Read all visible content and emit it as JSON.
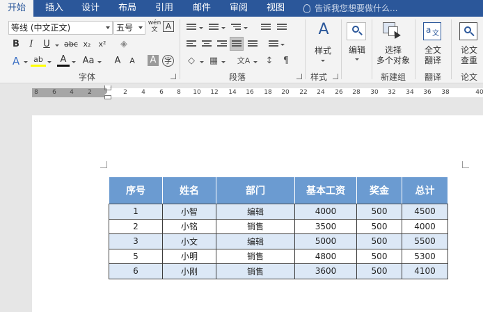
{
  "tabs": [
    {
      "label": "开始",
      "active": true
    },
    {
      "label": "插入"
    },
    {
      "label": "设计"
    },
    {
      "label": "布局"
    },
    {
      "label": "引用"
    },
    {
      "label": "邮件"
    },
    {
      "label": "审阅"
    },
    {
      "label": "视图"
    }
  ],
  "tell_me": "告诉我您想要做什么...",
  "ribbon": {
    "font_name": "等线 (中文正文)",
    "font_size": "五号",
    "pinyin_icon": "wén",
    "border_char_icon": "A",
    "bold": "B",
    "italic": "I",
    "underline": "U",
    "strike": "abc",
    "subscript": "x₂",
    "superscript": "x²",
    "text_effect": "A",
    "highlight": "ab",
    "font_color": "A",
    "change_case": "Aa",
    "grow_font": "A",
    "shrink_font": "A",
    "char_shading": "A",
    "enclosed_char": "字",
    "font_group": "字体",
    "paragraph_group": "段落",
    "styles_label": "样式",
    "styles_group": "样式",
    "edit_label": "编辑",
    "select_label_1": "选择",
    "select_label_2": "多个对象",
    "new_group": "新建组",
    "translate_label_1": "全文",
    "translate_label_2": "翻译",
    "translate_group": "翻译",
    "paper_label_1": "论文",
    "paper_label_2": "查重",
    "paper_group": "论文"
  },
  "ruler": {
    "left_ticks": [
      "8",
      "6",
      "4",
      "2"
    ],
    "right_ticks": [
      "2",
      "4",
      "6",
      "8",
      "10",
      "12",
      "14",
      "16",
      "18",
      "20",
      "22",
      "24",
      "26",
      "28",
      "30",
      "32",
      "34",
      "36",
      "38",
      "40"
    ]
  },
  "table": {
    "headers": [
      "序号",
      "姓名",
      "部门",
      "基本工资",
      "奖金",
      "总计"
    ],
    "rows": [
      [
        "1",
        "小智",
        "编辑",
        "4000",
        "500",
        "4500"
      ],
      [
        "2",
        "小铭",
        "销售",
        "3500",
        "500",
        "4000"
      ],
      [
        "3",
        "小文",
        "编辑",
        "5000",
        "500",
        "5500"
      ],
      [
        "5",
        "小明",
        "销售",
        "4800",
        "500",
        "5300"
      ],
      [
        "6",
        "小刚",
        "销售",
        "3600",
        "500",
        "4100"
      ]
    ]
  },
  "colors": {
    "title_bar": "#2b579a",
    "ribbon_bg": "#f3f3f3",
    "header_fill": "#6b9bd1",
    "band_fill": "#dce8f6"
  }
}
